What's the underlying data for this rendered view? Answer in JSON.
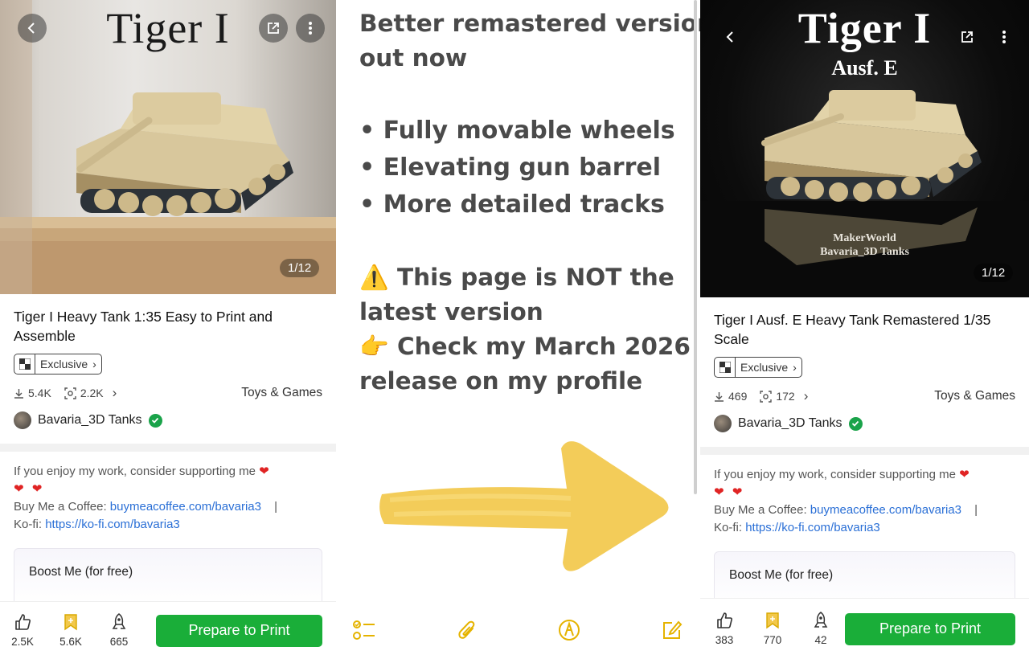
{
  "left": {
    "hero_title": "Tiger I",
    "image_counter": "1/12",
    "title": "Tiger I Heavy Tank 1:35 Easy to Print and Assemble",
    "badge": "Exclusive",
    "downloads": "5.4K",
    "prints": "2.2K",
    "category": "Toys & Games",
    "author": "Bavaria_3D Tanks",
    "description": {
      "line1": "If you enjoy my work, consider supporting me",
      "coffee_label": "Buy Me a Coffee:",
      "coffee_link": "buymeacoffee.com/bavaria3",
      "sep": "|",
      "kofi_label": "Ko-fi:",
      "kofi_link": "https://ko-fi.com/bavaria3"
    },
    "boost": "Boost Me (for free)",
    "likes": "2.5K",
    "collects": "5.6K",
    "boosts": "665",
    "print_button": "Prepare to Print"
  },
  "note": {
    "line1": "Better remastered version",
    "line2": "out now",
    "bullet1": "• Fully movable wheels",
    "bullet2": "• Elevating gun barrel",
    "bullet3": "• More detailed tracks",
    "warn_emoji": "⚠️",
    "warn1": "This page is NOT the",
    "warn2": "latest version",
    "point_emoji": "👉",
    "check1": "Check my March 2026",
    "check2": "release on my profile",
    "colors": {
      "text": "#4a4a4a",
      "arrow": "#f2c84b",
      "toolbar": "#e5b300"
    }
  },
  "right": {
    "hero_title": "Tiger I",
    "hero_subtitle": "Ausf. E",
    "watermark1": "MakerWorld",
    "watermark2": "Bavaria_3D Tanks",
    "image_counter": "1/12",
    "title": "Tiger I Ausf. E Heavy Tank Remastered 1/35 Scale",
    "badge": "Exclusive",
    "downloads": "469",
    "prints": "172",
    "category": "Toys & Games",
    "author": "Bavaria_3D Tanks",
    "description": {
      "line1": "If you enjoy my work, consider supporting me",
      "coffee_label": "Buy Me a Coffee:",
      "coffee_link": "buymeacoffee.com/bavaria3",
      "sep": "|",
      "kofi_label": "Ko-fi:",
      "kofi_link": "https://ko-fi.com/bavaria3"
    },
    "boost": "Boost Me (for free)",
    "likes": "383",
    "collects": "770",
    "boosts": "42",
    "print_button": "Prepare to Print"
  },
  "icons": [
    "back-icon",
    "share-icon",
    "more-icon",
    "download-icon",
    "print-count-icon",
    "chevron-right-icon",
    "verified-icon",
    "heart-icon",
    "like-icon",
    "collect-icon",
    "boost-icon",
    "checklist-icon",
    "paperclip-icon",
    "pen-icon",
    "compose-icon"
  ],
  "accent_colors": {
    "print_button": "#1aae39",
    "link": "#2a6fd6",
    "verified": "#1aa34a",
    "heart": "#e02424"
  }
}
